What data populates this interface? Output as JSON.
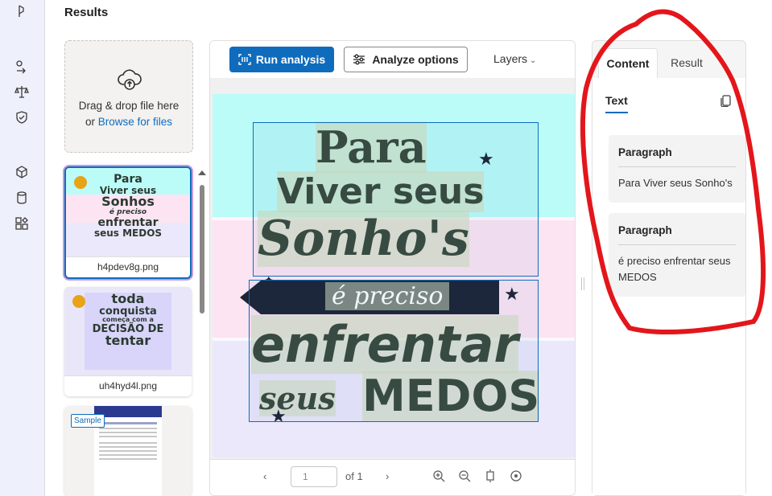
{
  "header": {
    "title": "Results"
  },
  "dropzone": {
    "line1": "Drag & drop file here",
    "or": "or",
    "browse": "Browse for files"
  },
  "files": [
    {
      "name": "h4pdev8g.png",
      "art": [
        "Para",
        "Viver seus",
        "Sonhos",
        "é preciso",
        "enfrentar",
        "seus MEDOS"
      ]
    },
    {
      "name": "uh4hyd4l.png",
      "art": [
        "toda",
        "conquista",
        "começa com a",
        "DECISÃO DE",
        "tentar"
      ]
    },
    {
      "name": "",
      "badge": "Sample"
    }
  ],
  "toolbar": {
    "run_label": "Run analysis",
    "analyze_label": "Analyze options",
    "layers_label": "Layers"
  },
  "document": {
    "line_para": "Para",
    "line_viver": "Viver seus",
    "line_sonhos": "Sonho's",
    "line_preciso": "é preciso",
    "line_enfrentar": "enfrentar",
    "line_seus": "seus",
    "line_medos": "MEDOS"
  },
  "pager": {
    "page_value": "1",
    "of_label": "of 1"
  },
  "right_panel": {
    "tabs": [
      {
        "label": "Content"
      },
      {
        "label": "Result"
      }
    ],
    "subtab": "Text",
    "paragraphs": [
      {
        "heading": "Paragraph",
        "text": "Para Viver seus Sonho's"
      },
      {
        "heading": "Paragraph",
        "text": "é preciso enfrentar seus MEDOS"
      }
    ]
  },
  "colors": {
    "accent": "#0f6cbd",
    "annotation": "#e3161b",
    "band_cyan": "#bbfcf9",
    "band_pink": "#fde4f2",
    "band_lavender": "#ece8fb"
  }
}
